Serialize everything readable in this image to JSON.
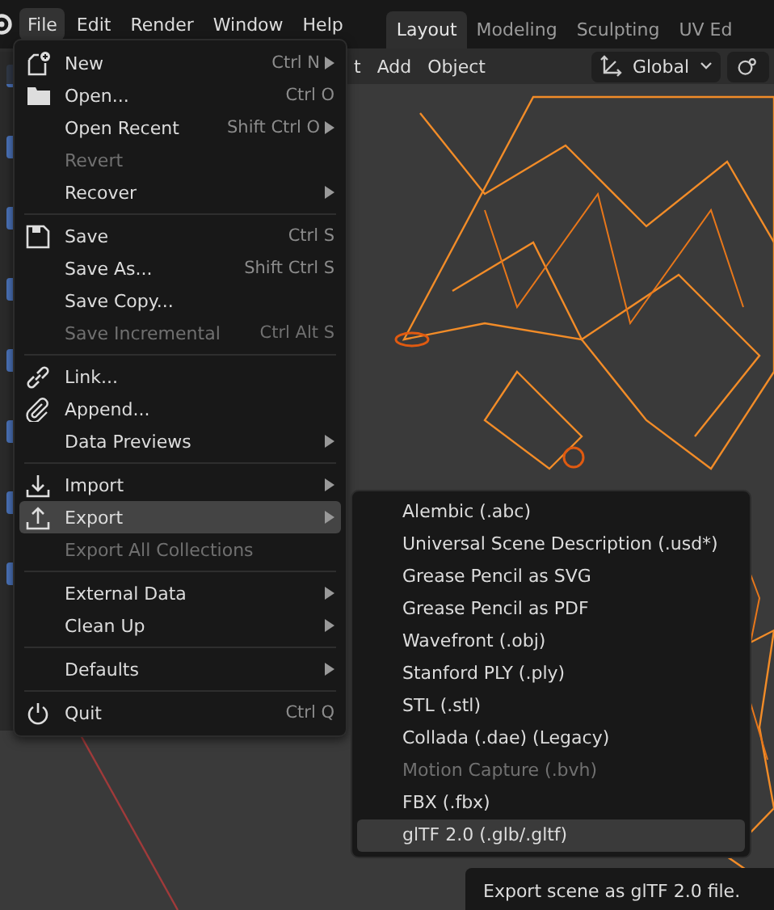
{
  "menubar": [
    {
      "label": "File",
      "selected": true
    },
    {
      "label": "Edit",
      "selected": false
    },
    {
      "label": "Render",
      "selected": false
    },
    {
      "label": "Window",
      "selected": false
    },
    {
      "label": "Help",
      "selected": false
    }
  ],
  "workspace_tabs": [
    {
      "label": "Layout",
      "selected": true
    },
    {
      "label": "Modeling",
      "selected": false
    },
    {
      "label": "Sculpting",
      "selected": false
    },
    {
      "label": "UV Ed",
      "selected": false
    }
  ],
  "viewport_header": {
    "menus": [
      "t",
      "Add",
      "Object"
    ],
    "orientation": "Global"
  },
  "file_menu": [
    [
      {
        "label": "New",
        "shortcut": "Ctrl N",
        "submenu": true,
        "disabled": false,
        "selected": false
      },
      {
        "label": "Open...",
        "shortcut": "Ctrl O",
        "submenu": false,
        "disabled": false,
        "selected": false
      },
      {
        "label": "Open Recent",
        "shortcut": "Shift Ctrl O",
        "submenu": true,
        "disabled": false,
        "selected": false
      },
      {
        "label": "Revert",
        "submenu": false,
        "disabled": true,
        "selected": false
      },
      {
        "label": "Recover",
        "submenu": true,
        "disabled": false,
        "selected": false
      }
    ],
    [
      {
        "label": "Save",
        "shortcut": "Ctrl S",
        "submenu": false,
        "disabled": false,
        "selected": false
      },
      {
        "label": "Save As...",
        "shortcut": "Shift Ctrl S",
        "submenu": false,
        "disabled": false,
        "selected": false
      },
      {
        "label": "Save Copy...",
        "submenu": false,
        "disabled": false,
        "selected": false
      },
      {
        "label": "Save Incremental",
        "shortcut": "Ctrl Alt S",
        "submenu": false,
        "disabled": true,
        "selected": false
      }
    ],
    [
      {
        "label": "Link...",
        "submenu": false,
        "disabled": false,
        "selected": false
      },
      {
        "label": "Append...",
        "submenu": false,
        "disabled": false,
        "selected": false
      },
      {
        "label": "Data Previews",
        "submenu": true,
        "disabled": false,
        "selected": false
      }
    ],
    [
      {
        "label": "Import",
        "submenu": true,
        "disabled": false,
        "selected": false
      },
      {
        "label": "Export",
        "submenu": true,
        "disabled": false,
        "selected": true
      },
      {
        "label": "Export All Collections",
        "submenu": false,
        "disabled": true,
        "selected": false
      }
    ],
    [
      {
        "label": "External Data",
        "submenu": true,
        "disabled": false,
        "selected": false
      },
      {
        "label": "Clean Up",
        "submenu": true,
        "disabled": false,
        "selected": false
      }
    ],
    [
      {
        "label": "Defaults",
        "submenu": true,
        "disabled": false,
        "selected": false
      }
    ],
    [
      {
        "label": "Quit",
        "shortcut": "Ctrl Q",
        "submenu": false,
        "disabled": false,
        "selected": false
      }
    ]
  ],
  "export_menu": [
    {
      "label": "Alembic (.abc)",
      "disabled": false,
      "selected": false
    },
    {
      "label": "Universal Scene Description (.usd*)",
      "disabled": false,
      "selected": false
    },
    {
      "label": "Grease Pencil as SVG",
      "disabled": false,
      "selected": false
    },
    {
      "label": "Grease Pencil as PDF",
      "disabled": false,
      "selected": false
    },
    {
      "label": "Wavefront (.obj)",
      "disabled": false,
      "selected": false
    },
    {
      "label": "Stanford PLY (.ply)",
      "disabled": false,
      "selected": false
    },
    {
      "label": "STL (.stl)",
      "disabled": false,
      "selected": false
    },
    {
      "label": "Collada (.dae) (Legacy)",
      "disabled": false,
      "selected": false
    },
    {
      "label": "Motion Capture (.bvh)",
      "disabled": true,
      "selected": false
    },
    {
      "label": "FBX (.fbx)",
      "disabled": false,
      "selected": false
    },
    {
      "label": "glTF 2.0 (.glb/.gltf)",
      "disabled": false,
      "selected": true
    }
  ],
  "tooltip": "Export scene as glTF 2.0 file."
}
